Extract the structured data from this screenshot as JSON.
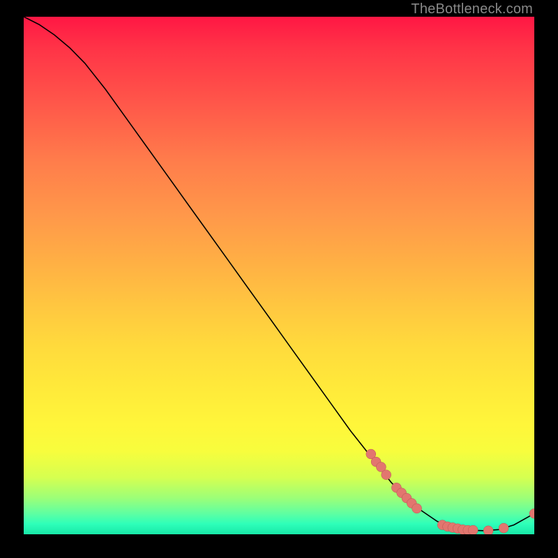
{
  "watermark": "TheBottleneck.com",
  "colors": {
    "line": "#000000",
    "marker_fill": "#e2766f",
    "marker_stroke": "#b85550"
  },
  "chart_data": {
    "type": "line",
    "title": "",
    "xlabel": "",
    "ylabel": "",
    "xlim": [
      0,
      100
    ],
    "ylim": [
      0,
      100
    ],
    "series": [
      {
        "name": "curve",
        "x": [
          0,
          3,
          6,
          9,
          12,
          16,
          20,
          24,
          28,
          32,
          36,
          40,
          44,
          48,
          52,
          56,
          60,
          64,
          68,
          72,
          75,
          78,
          81,
          84,
          87,
          90,
          93,
          96,
          100
        ],
        "y": [
          100,
          98.5,
          96.5,
          94,
          91,
          86,
          80.5,
          75,
          69.5,
          64,
          58.5,
          53,
          47.5,
          42,
          36.5,
          31,
          25.5,
          20,
          15,
          10,
          7,
          4.5,
          2.5,
          1.3,
          0.8,
          0.7,
          0.9,
          1.8,
          4
        ]
      }
    ],
    "markers": [
      {
        "x": 68,
        "y": 15.5
      },
      {
        "x": 69,
        "y": 14
      },
      {
        "x": 70,
        "y": 13
      },
      {
        "x": 71,
        "y": 11.5
      },
      {
        "x": 73,
        "y": 9
      },
      {
        "x": 74,
        "y": 8
      },
      {
        "x": 75,
        "y": 7
      },
      {
        "x": 76,
        "y": 6
      },
      {
        "x": 77,
        "y": 5
      },
      {
        "x": 82,
        "y": 1.8
      },
      {
        "x": 83,
        "y": 1.5
      },
      {
        "x": 84,
        "y": 1.3
      },
      {
        "x": 85,
        "y": 1.1
      },
      {
        "x": 86,
        "y": 0.9
      },
      {
        "x": 87,
        "y": 0.8
      },
      {
        "x": 88,
        "y": 0.8
      },
      {
        "x": 91,
        "y": 0.7
      },
      {
        "x": 94,
        "y": 1.2
      },
      {
        "x": 100,
        "y": 4
      }
    ]
  }
}
